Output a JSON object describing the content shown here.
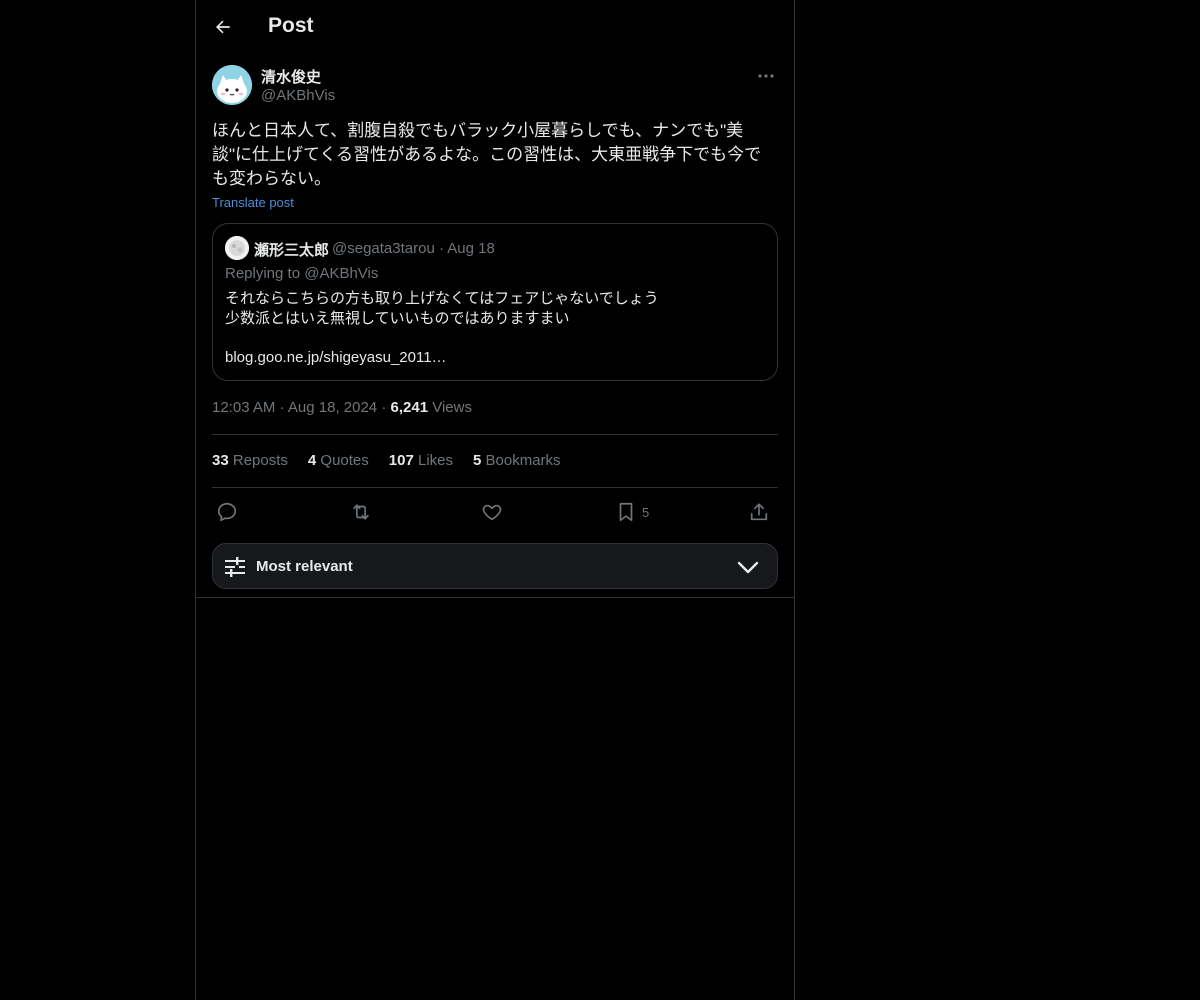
{
  "header": {
    "title": "Post"
  },
  "post": {
    "author": {
      "display_name": "清水俊史",
      "handle": "@AKBhVis"
    },
    "text": "ほんと日本人て、割腹自殺でもバラック小屋暮らしでも、ナンでも\"美談\"に仕上げてくる習性があるよな。この習性は、大東亜戦争下でも今でも変わらない。",
    "translate_label": "Translate post",
    "quote": {
      "display_name": "瀬形三太郎",
      "meta": "@segata3tarou · Aug 18",
      "replying_to": "Replying to @AKBhVis",
      "body": "それならこちらの方も取り上げなくてはフェアじゃないでしょう\n少数派とはいえ無視していいものではありますまい",
      "link": "blog.goo.ne.jp/shigeyasu_2011…"
    },
    "time": "12:03 AM",
    "date": "Aug 18, 2024",
    "views_count": "6,241",
    "views_label": "Views"
  },
  "stats": {
    "reposts_count": "33",
    "reposts_label": "Reposts",
    "quotes_count": "4",
    "quotes_label": "Quotes",
    "likes_count": "107",
    "likes_label": "Likes",
    "bookmarks_count": "5",
    "bookmarks_label": "Bookmarks"
  },
  "actions": {
    "bookmark_count": "5"
  },
  "sort": {
    "label": "Most relevant"
  },
  "colors": {
    "background": "#000000",
    "border": "#2f3336",
    "text_primary": "#e7e9ea",
    "text_secondary": "#71767b",
    "link": "#4c8fd6"
  }
}
